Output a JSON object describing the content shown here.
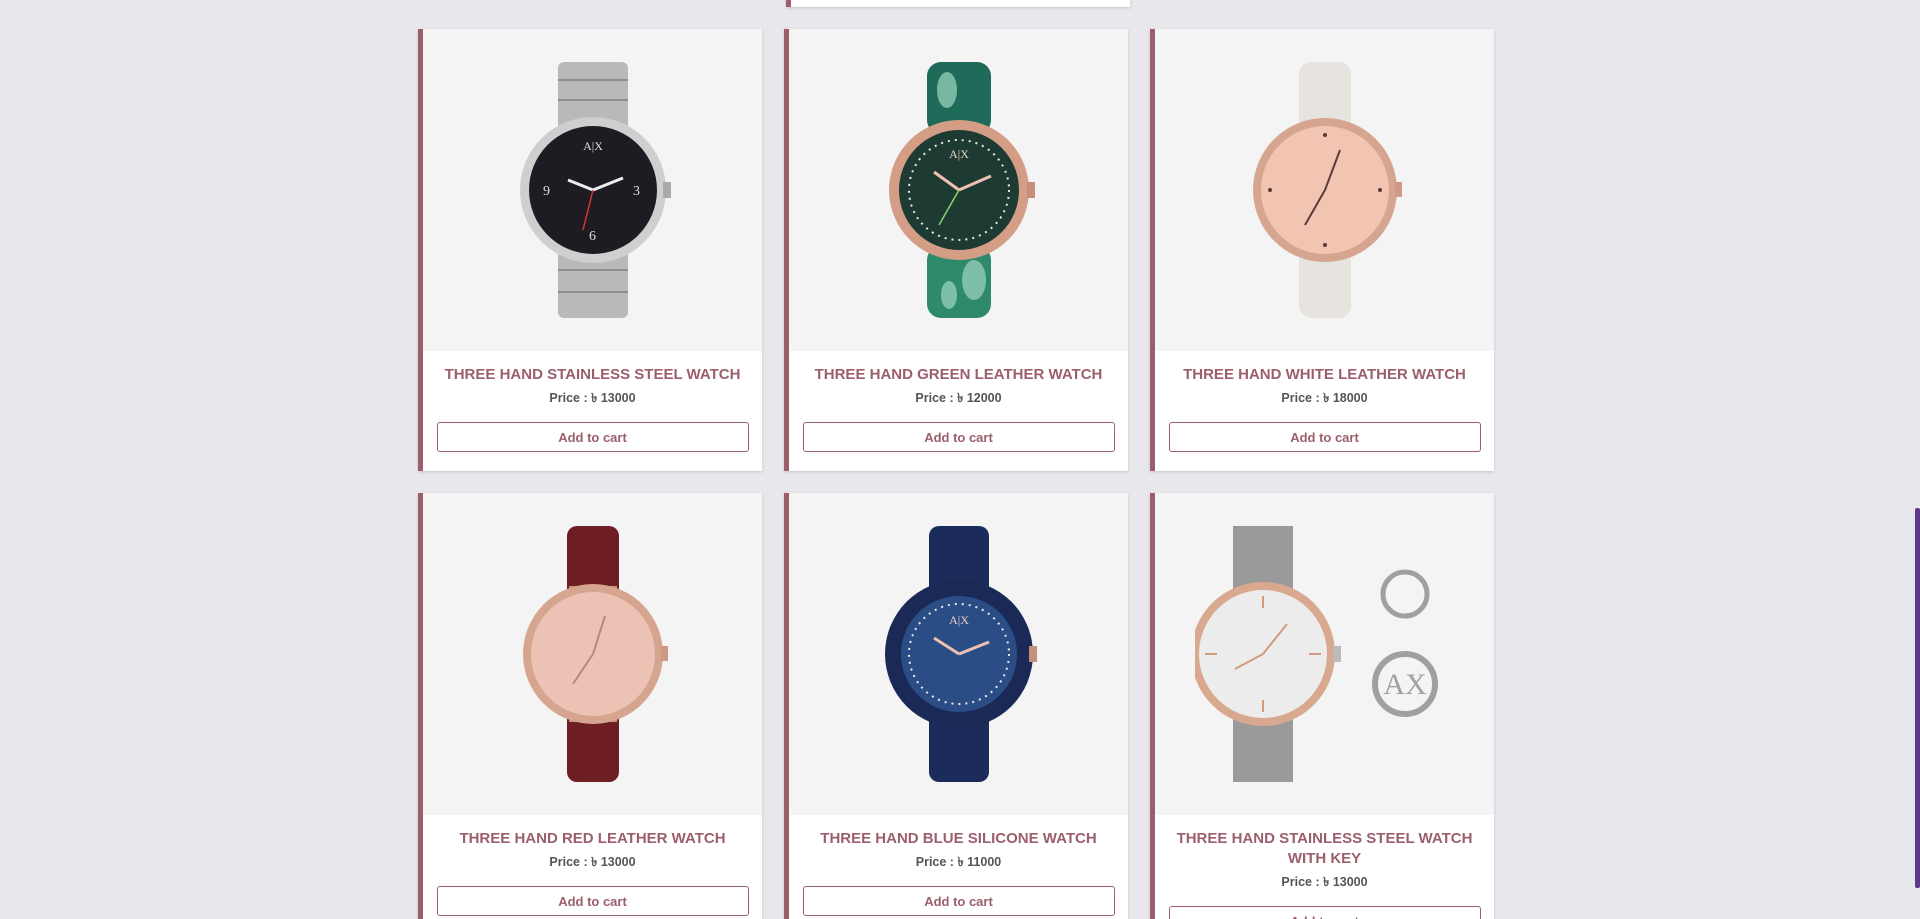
{
  "products": [
    {
      "title": "THREE HAND STAINLESS STEEL WATCH",
      "price_label": "Price :",
      "currency": "৳",
      "price": "13000",
      "button": "Add to cart",
      "image": "silver-steel-watch-black-dial"
    },
    {
      "title": "THREE HAND GREEN LEATHER WATCH",
      "price_label": "Price :",
      "currency": "৳",
      "price": "12000",
      "button": "Add to cart",
      "image": "green-floral-strap-watch"
    },
    {
      "title": "THREE HAND WHITE LEATHER WATCH",
      "price_label": "Price :",
      "currency": "৳",
      "price": "18000",
      "button": "Add to cart",
      "image": "white-strap-rose-gold-watch"
    },
    {
      "title": "THREE HAND RED LEATHER WATCH",
      "price_label": "Price :",
      "currency": "৳",
      "price": "13000",
      "button": "Add to cart",
      "image": "red-strap-rose-gold-watch"
    },
    {
      "title": "THREE HAND BLUE SILICONE WATCH",
      "price_label": "Price :",
      "currency": "৳",
      "price": "11000",
      "button": "Add to cart",
      "image": "blue-silicone-watch"
    },
    {
      "title": "THREE HAND STAINLESS STEEL WATCH WITH KEY",
      "price_label": "Price :",
      "currency": "৳",
      "price": "13000",
      "button": "Add to cart",
      "image": "mesh-steel-watch-with-keyring"
    }
  ],
  "colors": {
    "accent": "#9b5f6c",
    "background": "#e8e8ec",
    "scrollbar": "#5b3a8e"
  }
}
